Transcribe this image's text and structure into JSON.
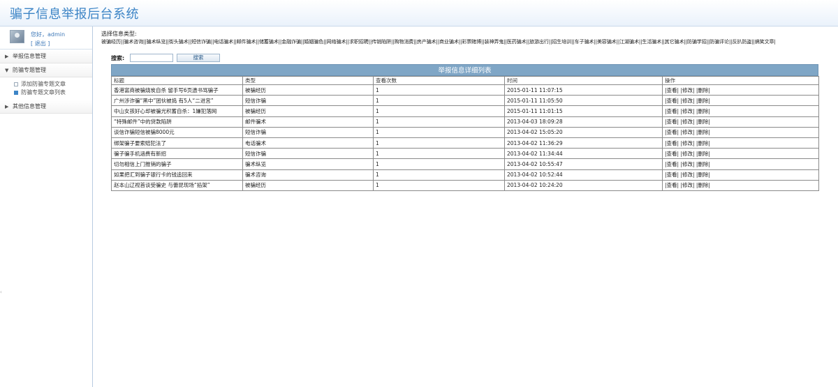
{
  "app": {
    "title": "骗子信息举报后台系统"
  },
  "user": {
    "greeting": "您好，admin",
    "logout": "[ 退出 ]"
  },
  "sidebar": {
    "sections": [
      {
        "label": "举报信息管理",
        "expanded": false
      },
      {
        "label": "防骗专题管理",
        "expanded": true,
        "items": [
          {
            "label": "添加防骗专题文章",
            "active": false
          },
          {
            "label": "防骗专题文章列表",
            "active": true
          }
        ]
      },
      {
        "label": "其他信息管理",
        "expanded": false
      }
    ]
  },
  "categories": {
    "label": "选择信息类型:",
    "items": [
      "被骗经历",
      "骗术咨询",
      "骗术纵览",
      "街头骗术",
      "短信诈骗",
      "电话骗术",
      "邮件骗术",
      "储蓄骗术",
      "金融诈骗",
      "婚姻骗色",
      "网络骗术",
      "求职招聘",
      "传销陷阱",
      "购物消费",
      "房产骗术",
      "商业骗术",
      "彩票赌博",
      "装神弄鬼",
      "医药骗术",
      "旅游出行",
      "招生培训",
      "车子骗术",
      "美容骗术",
      "江湖骗术",
      "生活骗术",
      "其它骗术",
      "防骗学招",
      "防骗评论",
      "反扒防盗",
      "搞笑文章"
    ]
  },
  "search": {
    "label": "搜索:",
    "value": "",
    "button": "搜索"
  },
  "table": {
    "caption": "举报信息详细列表",
    "headers": [
      "标题",
      "类型",
      "查看次数",
      "时间",
      "操作"
    ],
    "op_view": "|查看|",
    "op_edit": "|修改|",
    "op_delete": "|删除|",
    "rows": [
      {
        "title": "香港富商被骗烧炭自杀 留手写6页遗书骂骗子",
        "type": "被骗经历",
        "views": "1",
        "time": "2015-01-11 11:07:15"
      },
      {
        "title": "广州涉诈骗“黑中”团伙被捣 有5人“二进宫”",
        "type": "短信诈骗",
        "views": "1",
        "time": "2015-01-11 11:05:50"
      },
      {
        "title": "中山女孩好心却被骗光积蓄自杀：1嫌犯落网",
        "type": "被骗经历",
        "views": "1",
        "time": "2015-01-11 11:01:15"
      },
      {
        "title": "“特殊邮件”中的贷款陷阱",
        "type": "邮件骗术",
        "views": "1",
        "time": "2013-04-03 18:09:28"
      },
      {
        "title": "谈信诈骗短信被骗8000元",
        "type": "短信诈骗",
        "views": "1",
        "time": "2013-04-02 15:05:20"
      },
      {
        "title": "绑架骗子要索赔犯法了",
        "type": "电话骗术",
        "views": "1",
        "time": "2013-04-02 11:36:29"
      },
      {
        "title": "骗子骗手机涵费有新招",
        "type": "短信诈骗",
        "views": "1",
        "time": "2013-04-02 11:34:44"
      },
      {
        "title": "切勿相信上门推销的骗子",
        "type": "骗术纵览",
        "views": "1",
        "time": "2013-04-02 10:55:47"
      },
      {
        "title": "如果把汇到骗子银行卡的钱追回来",
        "type": "骗术咨询",
        "views": "1",
        "time": "2013-04-02 10:52:44"
      },
      {
        "title": "赵本山辽视首谈受骗史 与蕾昆现场“掐架”",
        "type": "被骗经历",
        "views": "1",
        "time": "2013-04-02 10:24:20"
      }
    ]
  },
  "colors": {
    "title": "#3d85c6",
    "caption_bg": "#7fa6c6",
    "sidebar_border": "#b9cbe0"
  }
}
